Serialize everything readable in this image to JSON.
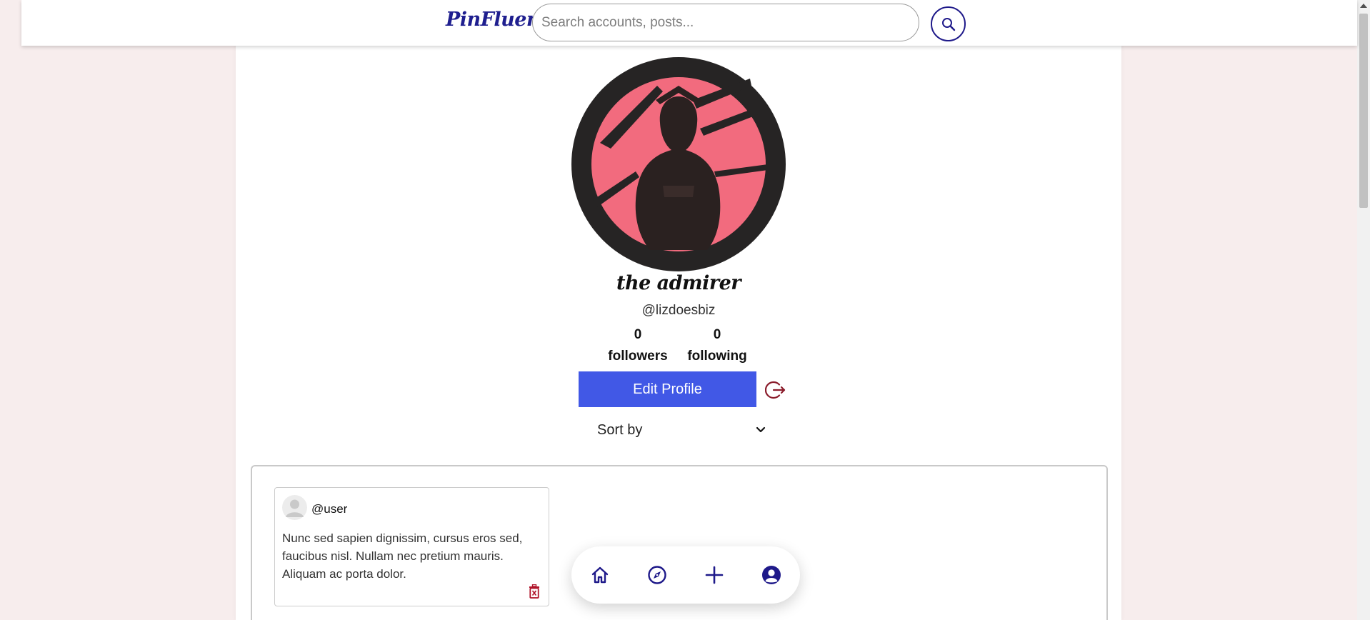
{
  "header": {
    "logo": "PinFluence",
    "search_placeholder": "Search accounts, posts...",
    "search_icon": "search-icon"
  },
  "profile": {
    "display_name": "the admirer",
    "handle": "@lizdoesbiz",
    "followers_count": "0",
    "followers_label": "followers",
    "following_count": "0",
    "following_label": "following",
    "edit_button_label": "Edit Profile",
    "logout_icon": "logout-icon",
    "sort_label": "Sort by"
  },
  "posts": [
    {
      "user": "@user",
      "text": "Nunc sed sapien dignissim, cursus eros sed, faucibus nisl. Nullam nec pretium mauris. Aliquam ac porta dolor.",
      "delete_icon": "trash-icon"
    }
  ],
  "bottom_nav": {
    "items": [
      "home-icon",
      "compass-icon",
      "plus-icon",
      "user-circle-icon"
    ]
  },
  "colors": {
    "brand": "#1f1f8f",
    "accent_button": "#4158e6",
    "logout": "#8b1d2c",
    "page_background": "#f7eded",
    "avatar_pink": "#f26b7e",
    "avatar_dark": "#262424"
  }
}
